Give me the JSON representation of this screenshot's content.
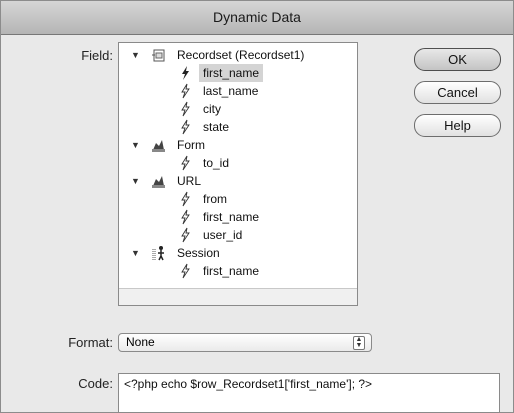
{
  "window": {
    "title": "Dynamic Data"
  },
  "labels": {
    "field": "Field:",
    "format": "Format:",
    "code": "Code:"
  },
  "tree": {
    "groups": [
      {
        "label": "Recordset (Recordset1)",
        "icon": "recordset-icon",
        "items": [
          "first_name",
          "last_name",
          "city",
          "state"
        ]
      },
      {
        "label": "Form",
        "icon": "form-icon",
        "items": [
          "to_id"
        ]
      },
      {
        "label": "URL",
        "icon": "url-icon",
        "items": [
          "from",
          "first_name",
          "user_id"
        ]
      },
      {
        "label": "Session",
        "icon": "session-icon",
        "items": [
          "first_name"
        ]
      }
    ],
    "selected": "first_name"
  },
  "buttons": {
    "ok": "OK",
    "cancel": "Cancel",
    "help": "Help"
  },
  "format": {
    "value": "None"
  },
  "code": {
    "value": "<?php echo $row_Recordset1['first_name']; ?>"
  }
}
